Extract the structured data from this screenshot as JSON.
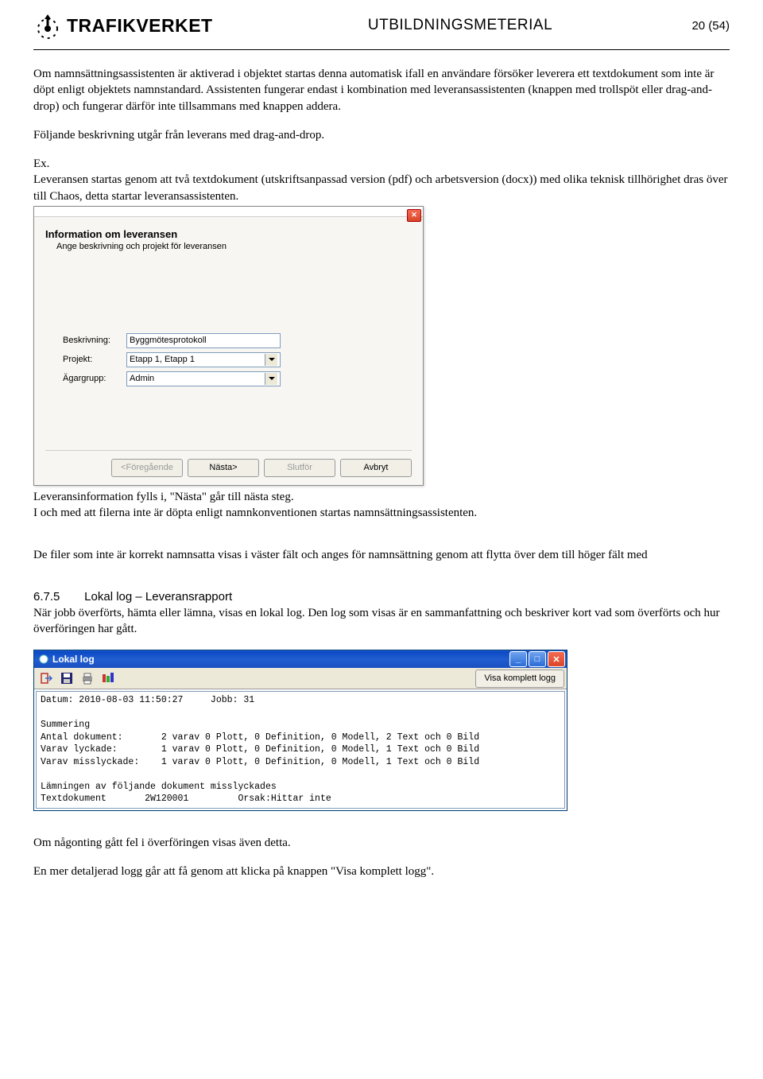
{
  "header": {
    "brand": "TRAFIKVERKET",
    "title": "UTBILDNINGSMETERIAL",
    "page": "20 (54)"
  },
  "para1": "Om namnsättningsassistenten är aktiverad i objektet startas denna automatisk ifall en användare försöker leverera ett textdokument som inte är döpt enligt objektets namnstandard. Assistenten fungerar endast i kombination med leveransassistenten (knappen med trollspöt eller drag-and-drop) och fungerar därför inte tillsammans med knappen addera.",
  "para2": "Följande beskrivning utgår från leverans med drag-and-drop.",
  "para3_label": "Ex.",
  "para3": "Leveransen startas genom att två textdokument (utskriftsanpassad version (pdf) och arbetsversion (docx)) med olika teknisk tillhörighet dras över till Chaos, detta startar leveransassistenten.",
  "dialog1": {
    "heading": "Information om leveransen",
    "sub": "Ange beskrivning och projekt för leveransen",
    "field_beskrivning_label": "Beskrivning:",
    "field_beskrivning_value": "Byggmötesprotokoll",
    "field_projekt_label": "Projekt:",
    "field_projekt_value": "Etapp 1, Etapp 1",
    "field_agargrupp_label": "Ägargrupp:",
    "field_agargrupp_value": "Admin",
    "btn_prev": "<Föregående",
    "btn_next": "Nästa>",
    "btn_finish": "Slutför",
    "btn_cancel": "Avbryt"
  },
  "para4": "Leveransinformation fylls i, \"Nästa\" går till nästa steg.",
  "para5": "I och med att filerna inte är döpta enligt namnkonventionen startas namnsättningsassistenten.",
  "para6": "De filer som inte är korrekt namnsatta visas i väster fält och anges för namnsättning genom att flytta över dem till höger fält med",
  "section": {
    "num": "6.7.5",
    "title": "Lokal log – Leveransrapport"
  },
  "para7": "När jobb överförts, hämta eller lämna, visas en lokal log. Den log som visas är en sammanfattning och beskriver kort vad som överförts och hur överföringen har gått.",
  "dialog2": {
    "title": "Lokal log",
    "btn_full": "Visa komplett logg",
    "line1": "Datum: 2010-08-03 11:50:27     Jobb: 31",
    "line2": "Summering",
    "line3": "Antal dokument:       2 varav 0 Plott, 0 Definition, 0 Modell, 2 Text och 0 Bild",
    "line4": "Varav lyckade:        1 varav 0 Plott, 0 Definition, 0 Modell, 1 Text och 0 Bild",
    "line5": "Varav misslyckade:    1 varav 0 Plott, 0 Definition, 0 Modell, 1 Text och 0 Bild",
    "line6": "Lämningen av följande dokument misslyckades",
    "line7": "Textdokument       2W120001         Orsak:Hittar inte"
  },
  "para8": "Om någonting gått fel i överföringen visas även detta.",
  "para9": "En mer detaljerad logg går att få genom att klicka på knappen \"Visa komplett logg\"."
}
